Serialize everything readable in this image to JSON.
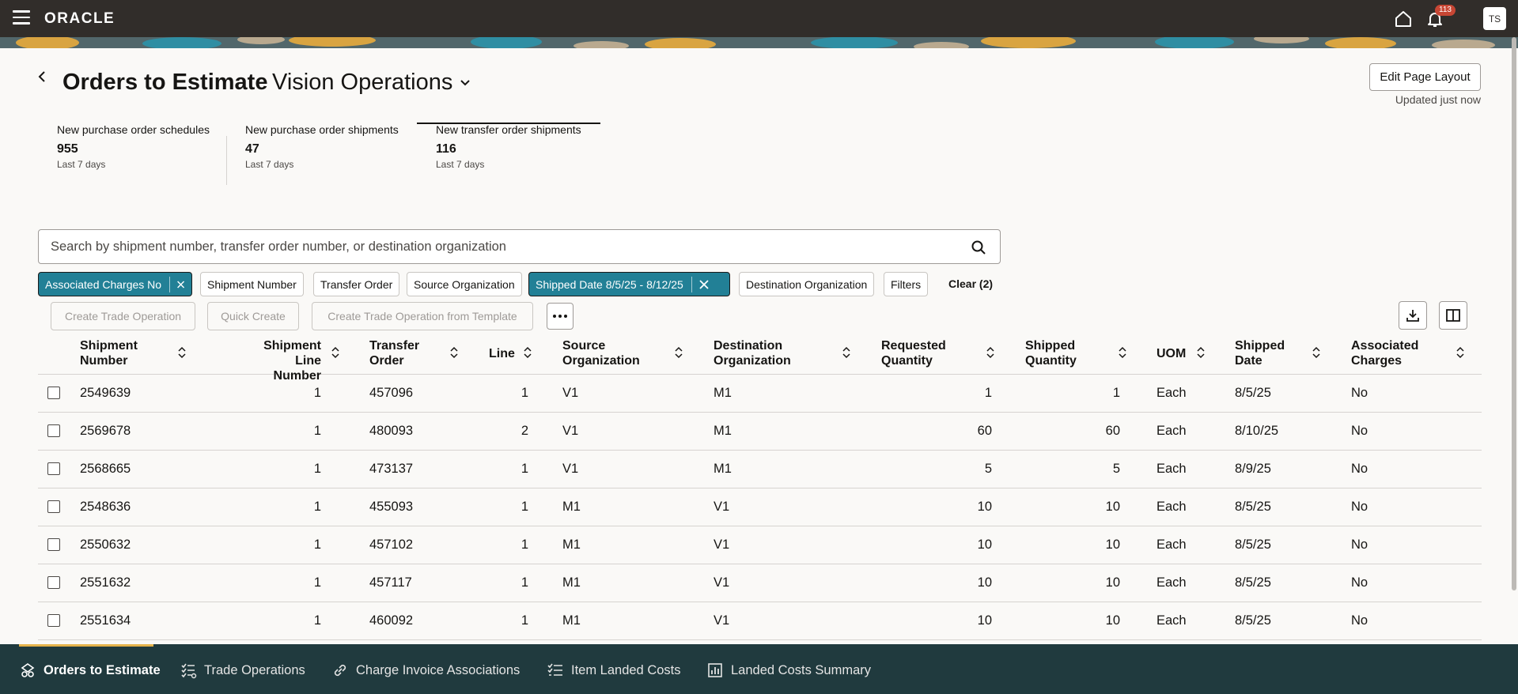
{
  "topbar": {
    "logo": "ORACLE",
    "notification_count": "113",
    "avatar_initials": "TS",
    "icons": [
      "menu-icon",
      "home-icon",
      "bell-icon"
    ]
  },
  "header": {
    "title": "Orders to Estimate",
    "organization": "Vision Operations",
    "edit_layout_label": "Edit Page Layout",
    "updated_text": "Updated just now"
  },
  "metrics": [
    {
      "label": "New purchase order schedules",
      "value": "955",
      "period": "Last 7 days",
      "active": false
    },
    {
      "label": "New purchase order shipments",
      "value": "47",
      "period": "Last 7 days",
      "active": false
    },
    {
      "label": "New transfer order shipments",
      "value": "116",
      "period": "Last 7 days",
      "active": true
    }
  ],
  "search": {
    "placeholder": "Search by shipment number, transfer order number, or destination organization",
    "value": ""
  },
  "filters": {
    "chips": [
      {
        "label": "Associated Charges No",
        "active": true
      },
      {
        "label": "Shipment Number",
        "active": false
      },
      {
        "label": "Transfer Order",
        "active": false
      },
      {
        "label": "Source Organization",
        "active": false
      },
      {
        "label": "Shipped Date 8/5/25 - 8/12/25",
        "active": true
      },
      {
        "label": "Destination Organization",
        "active": false
      },
      {
        "label": "Filters",
        "active": false
      }
    ],
    "clear_label": "Clear (2)"
  },
  "actions": {
    "create_trade_operation": "Create Trade Operation",
    "quick_create": "Quick Create",
    "create_from_template": "Create Trade Operation from Template",
    "more_label": "..."
  },
  "table": {
    "columns": [
      {
        "l1": "Shipment",
        "l2": "Number"
      },
      {
        "l1": "Shipment Line",
        "l2": "Number"
      },
      {
        "l1": "Transfer",
        "l2": "Order"
      },
      {
        "l1": "Line",
        "l2": ""
      },
      {
        "l1": "Source",
        "l2": "Organization"
      },
      {
        "l1": "Destination",
        "l2": "Organization"
      },
      {
        "l1": "Requested",
        "l2": "Quantity"
      },
      {
        "l1": "Shipped",
        "l2": "Quantity"
      },
      {
        "l1": "UOM",
        "l2": ""
      },
      {
        "l1": "Shipped",
        "l2": "Date"
      },
      {
        "l1": "Associated",
        "l2": "Charges"
      }
    ],
    "rows": [
      [
        "2549639",
        "1",
        "457096",
        "1",
        "V1",
        "M1",
        "1",
        "1",
        "Each",
        "8/5/25",
        "No"
      ],
      [
        "2569678",
        "1",
        "480093",
        "2",
        "V1",
        "M1",
        "60",
        "60",
        "Each",
        "8/10/25",
        "No"
      ],
      [
        "2568665",
        "1",
        "473137",
        "1",
        "V1",
        "M1",
        "5",
        "5",
        "Each",
        "8/9/25",
        "No"
      ],
      [
        "2548636",
        "1",
        "455093",
        "1",
        "M1",
        "V1",
        "10",
        "10",
        "Each",
        "8/5/25",
        "No"
      ],
      [
        "2550632",
        "1",
        "457102",
        "1",
        "M1",
        "V1",
        "10",
        "10",
        "Each",
        "8/5/25",
        "No"
      ],
      [
        "2551632",
        "1",
        "457117",
        "1",
        "M1",
        "V1",
        "10",
        "10",
        "Each",
        "8/5/25",
        "No"
      ],
      [
        "2551634",
        "1",
        "460092",
        "1",
        "M1",
        "V1",
        "10",
        "10",
        "Each",
        "8/5/25",
        "No"
      ]
    ]
  },
  "bottom_nav": [
    {
      "label": "Orders to Estimate",
      "icon": "orders-icon",
      "active": true
    },
    {
      "label": "Trade Operations",
      "icon": "checklist-icon",
      "active": false
    },
    {
      "label": "Charge Invoice Associations",
      "icon": "link-icon",
      "active": false
    },
    {
      "label": "Item Landed Costs",
      "icon": "list-icon",
      "active": false
    },
    {
      "label": "Landed Costs Summary",
      "icon": "bar-chart-icon",
      "active": false
    }
  ],
  "colors": {
    "topbar": "#312d2a",
    "chip_active": "#228096",
    "bottom_nav": "#203a3e",
    "nav_accent": "#e5b34b",
    "badge": "#c74634"
  }
}
